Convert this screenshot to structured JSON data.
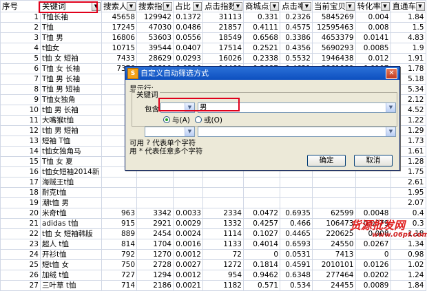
{
  "headers": [
    "序号",
    "关键词",
    "搜索人气",
    "搜索指数",
    "占比",
    "点击指数",
    "商城点击",
    "点击率",
    "当前宝贝数",
    "转化率",
    "直通车"
  ],
  "rows": [
    [
      "1",
      "T恤长袖",
      "45658",
      "129942",
      "0.1372",
      "31113",
      "0.331",
      "0.2326",
      "5845269",
      "0.004",
      "1.84"
    ],
    [
      "2",
      "T恤",
      "17245",
      "47030",
      "0.0486",
      "21857",
      "0.4111",
      "0.4575",
      "12595463",
      "0.008",
      "1.5"
    ],
    [
      "3",
      "T恤 男",
      "16806",
      "53603",
      "0.0556",
      "18549",
      "0.6568",
      "0.3386",
      "4653379",
      "0.0141",
      "4.83"
    ],
    [
      "4",
      "t恤女",
      "10715",
      "39544",
      "0.0407",
      "17514",
      "0.2521",
      "0.4356",
      "5690293",
      "0.0085",
      "1.9"
    ],
    [
      "5",
      "t恤 女 短袖",
      "7433",
      "28629",
      "0.0293",
      "16026",
      "0.2338",
      "0.5532",
      "1946438",
      "0.012",
      "1.91"
    ],
    [
      "6",
      "T恤 女 长袖",
      "7376",
      "30810",
      "0.0316",
      "14460",
      "0.3987",
      "0.4621",
      "3361989",
      "0.0107",
      "1.78"
    ],
    [
      "7",
      "T恤 男 长袖",
      "",
      "",
      "",
      "",
      "",
      "",
      "",
      "",
      "5.18"
    ],
    [
      "8",
      "T恤 男 短袖",
      "",
      "",
      "",
      "",
      "",
      "",
      "",
      "",
      "5.34"
    ],
    [
      "9",
      "T恤女独角",
      "",
      "",
      "",
      "",
      "",
      "",
      "",
      "",
      "2.12"
    ],
    [
      "10",
      "t恤 男 长袖",
      "",
      "",
      "",
      "",
      "",
      "",
      "",
      "",
      "4.52"
    ],
    [
      "11",
      "大嘴猴t恤",
      "",
      "",
      "",
      "",
      "",
      "",
      "",
      "",
      "1.22"
    ],
    [
      "12",
      "t恤 男 短袖",
      "",
      "",
      "",
      "",
      "",
      "",
      "",
      "",
      "1.29"
    ],
    [
      "13",
      "短袖 T恤",
      "",
      "",
      "",
      "",
      "",
      "",
      "",
      "",
      "1.73"
    ],
    [
      "14",
      "t恤女独角马",
      "",
      "",
      "",
      "",
      "",
      "",
      "",
      "",
      "1.61"
    ],
    [
      "15",
      "T恤 女 夏",
      "",
      "",
      "",
      "",
      "",
      "",
      "",
      "",
      "1.28"
    ],
    [
      "16",
      "t恤女短袖2014新",
      "",
      "",
      "",
      "",
      "",
      "",
      "",
      "",
      "1.75"
    ],
    [
      "17",
      "海贼王t恤",
      "",
      "",
      "",
      "",
      "",
      "",
      "",
      "",
      "2.61"
    ],
    [
      "18",
      "耐克t恤",
      "",
      "",
      "",
      "",
      "",
      "",
      "",
      "",
      "1.95"
    ],
    [
      "19",
      "潮t恤 男",
      "",
      "",
      "",
      "",
      "",
      "",
      "",
      "",
      "2.07"
    ],
    [
      "20",
      "米奇t恤",
      "963",
      "3342",
      "0.0033",
      "2334",
      "0.0472",
      "0.6935",
      "62599",
      "0.0048",
      "0.4"
    ],
    [
      "21",
      "adidas t恤",
      "915",
      "2921",
      "0.0029",
      "1332",
      "0.4257",
      "0.466",
      "106473",
      "0.0079",
      "0.3"
    ],
    [
      "22",
      "t恤 女 短袖韩版",
      "889",
      "2454",
      "0.0024",
      "1114",
      "0.1027",
      "0.4465",
      "220625",
      "0.008",
      "1.18"
    ],
    [
      "23",
      "超人 t恤",
      "814",
      "1704",
      "0.0016",
      "1133",
      "0.4014",
      "0.6593",
      "24550",
      "0.0267",
      "1.34"
    ],
    [
      "24",
      "开衫t恤",
      "792",
      "1270",
      "0.0012",
      "72",
      "0",
      "0.0531",
      "7413",
      "0",
      "0.98"
    ],
    [
      "25",
      "短t恤 女",
      "750",
      "2728",
      "0.0027",
      "1272",
      "0.1814",
      "0.4591",
      "2010101",
      "0.0126",
      "1.02"
    ],
    [
      "26",
      "加绒 t恤",
      "727",
      "1294",
      "0.0012",
      "954",
      "0.9462",
      "0.6348",
      "277464",
      "0.0202",
      "1.24"
    ],
    [
      "27",
      "三叶草 t恤",
      "714",
      "2186",
      "0.0021",
      "1182",
      "0.571",
      "0.534",
      "24455",
      "0.0089",
      "1.84"
    ]
  ],
  "dialog": {
    "title": "自定义自动筛选方式",
    "app_icon": "S",
    "show_rows": "显示行:",
    "field": "关键词",
    "operator1": "包含",
    "value1": "男",
    "and_label": "与(A)",
    "or_label": "或(O)",
    "operator2": "",
    "value2": "",
    "hint1": "可用 ? 代表单个字符",
    "hint2": "用 * 代表任意多个字符",
    "ok": "确定",
    "cancel": "取消"
  },
  "watermark": {
    "line1": "货源批发网",
    "line2": "www.06pf.com"
  }
}
